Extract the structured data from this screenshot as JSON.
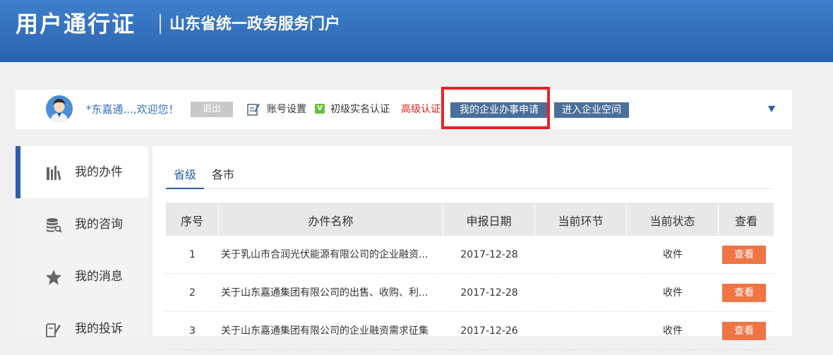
{
  "header": {
    "brand": "用户通行证",
    "subtitle": "山东省统一政务服务门户"
  },
  "userbar": {
    "welcome": "*东嘉通...,欢迎您！",
    "logout_label": "退出",
    "settings_label": "账号设置",
    "verified_badge": "V",
    "basic_auth_label": "初级实名认证",
    "advanced_auth_label": "高级认证",
    "enterprise_apply_label": "我的企业办事申请",
    "enterprise_space_label": "进入企业空间"
  },
  "sidebar": {
    "items": [
      {
        "label": "我的办件",
        "icon": "books-icon",
        "active": true
      },
      {
        "label": "我的咨询",
        "icon": "database-search-icon"
      },
      {
        "label": "我的消息",
        "icon": "star-icon"
      },
      {
        "label": "我的投诉",
        "icon": "complaint-edit-icon"
      }
    ]
  },
  "tabs": [
    {
      "label": "省级",
      "active": true
    },
    {
      "label": "各市"
    }
  ],
  "table": {
    "headers": [
      "序号",
      "办件名称",
      "申报日期",
      "当前环节",
      "当前状态",
      "查看"
    ],
    "rows": [
      {
        "no": "1",
        "name": "关于乳山市合润光伏能源有限公司的企业融资...",
        "date": "2017-12-28",
        "step": "",
        "status": "收件",
        "view": "查看"
      },
      {
        "no": "2",
        "name": "关于山东嘉通集团有限公司的出售、收购、利...",
        "date": "2017-12-28",
        "step": "",
        "status": "收件",
        "view": "查看"
      },
      {
        "no": "3",
        "name": "关于山东嘉通集团有限公司的企业融资需求征集",
        "date": "2017-12-26",
        "step": "",
        "status": "收件",
        "view": "查看"
      }
    ]
  },
  "colors": {
    "header_blue": "#2a63ad",
    "accent_blue": "#2a5ea8",
    "highlight_red": "#ec2027",
    "view_button_orange": "#f07545",
    "advanced_auth_red": "#d9231d"
  }
}
